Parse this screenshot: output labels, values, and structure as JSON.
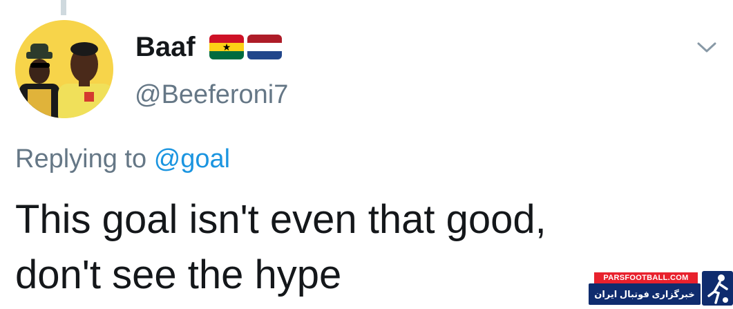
{
  "tweet": {
    "author": {
      "display_name": "Baaf",
      "handle": "@Beeferoni7",
      "flags": [
        "ghana-flag",
        "netherlands-flag"
      ]
    },
    "reply_prefix": "Replying to",
    "reply_to": "@goal",
    "text": "This goal isn't even that good, don't see the hype",
    "menu_icon": "chevron-down-icon"
  },
  "watermark": {
    "url": "PARSFOOTBALL.COM",
    "tagline": "خبرگزاری فوتبال ایران"
  },
  "colors": {
    "text_primary": "#14171a",
    "text_secondary": "#657786",
    "link": "#1b95e0",
    "avatar_bg": "#f7d44a",
    "watermark_blue": "#0f2c6e",
    "watermark_red": "#e8212d"
  }
}
